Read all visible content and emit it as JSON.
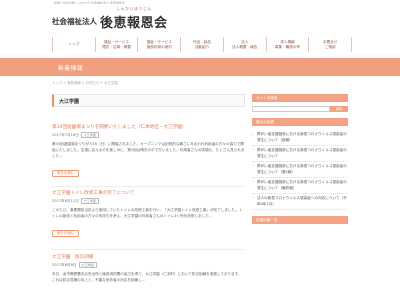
{
  "topline": "地域と共生の新しいかたち 社会福祉法人 後恵報恩会",
  "logo": {
    "ruby": "しゃかいほうじん",
    "corp": "社会福祉法人",
    "name": "後恵報恩会"
  },
  "nav": [
    "トップ",
    "福祉・サービス\n理念・沿革・概要",
    "福祉・サービス\n施設利用の案内",
    "作品・製品\n活動紹介",
    "法人\n法人概要・報告",
    "求人情報\n募集・職員の声",
    "お問合せ\nご相談"
  ],
  "banner": {
    "title": "新着情報"
  },
  "breadcrumb": "トップ > 新着情報 > お知らせ > 大江学園",
  "main": {
    "heading": "大江学園",
    "posts": [
      {
        "title": "第34回遊園場まつりを開催いたしました（仁本地区・大江学園）",
        "date": "2017年7月16日",
        "tag": "大江学園",
        "body": "第34回遊園場まつりが7/16（日）に開催されました。オープニングは記録的な暑さにみまわれ利用者の方々の協力で開始いたしました。友達に会えるのを楽しみに、第2回は晴天の中で行いました。利用者さんの笑顔も、たくさん見られました…",
        "more": "続きを読む"
      },
      {
        "title": "大江学園トイレ改修工事の完了について",
        "date": "2017年6月12日",
        "tag": "大江学園",
        "body": "このたび、事業開設当初より使用していたトイレの改修工事を行い、「大江学園トイレ改修工事」が完了しました。トイレの新設と利用者の方々の気持ちを考え、大江学園の利用者さんのトイレ3ヶ所を改修しました…",
        "more": "続きを読む"
      },
      {
        "title": "大江学園　防災訓練",
        "date": "2017年6月8日",
        "tag": "大江学園",
        "body": "本日、余市警察署北伝安全係と綾部消防署の協力を得て、大江学園（仁本町）において防災訓練を実施しております。これは防災意識の向上と、不審な来訪者の対応を訓練し…"
      }
    ]
  },
  "sidebar": {
    "search_head": "サイト内検索",
    "search_placeholder": "",
    "search_button": "検索",
    "recent_head": "最近の投稿",
    "recent": [
      "障がい者支援施設における新型コロナウイルス感染症の発生について（続報）",
      "障がい者支援施設における新型コロナウイルス感染症の発生について",
      "障がい者支援施設における新型コロナウイルス感染症の発生について（第2報）",
      "障がい者支援施設における新型コロナウイルス感染症の発生について（最終報）",
      "法人の新型コロナウイルス感染症への対応について（令和4年1月）"
    ],
    "archive_head": "投稿記事一覧"
  }
}
